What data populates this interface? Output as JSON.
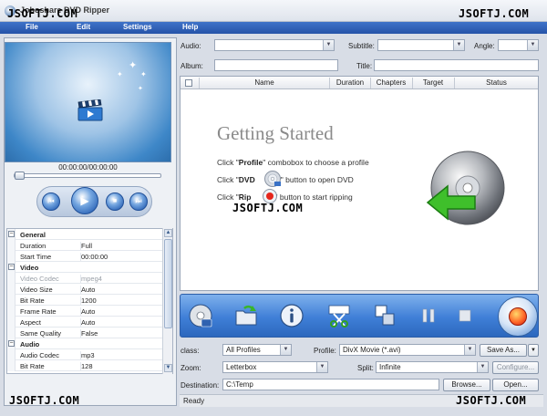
{
  "window": {
    "title": "Joboshare DVD Ripper",
    "watermark": "JSOFTJ.COM"
  },
  "menu": [
    {
      "label": "File"
    },
    {
      "label": "Edit"
    },
    {
      "label": "Settings"
    },
    {
      "label": "Help"
    }
  ],
  "player": {
    "time": "00:00:00/00:00:00",
    "seek_progress": 0.0
  },
  "properties": {
    "groups": [
      {
        "name": "General",
        "rows": [
          {
            "name": "Duration",
            "value": "Full"
          },
          {
            "name": "Start Time",
            "value": "00:00:00"
          }
        ]
      },
      {
        "name": "Video",
        "rows": [
          {
            "name": "Video Codec",
            "value": "mpeg4",
            "disabled": true
          },
          {
            "name": "Video Size",
            "value": "Auto"
          },
          {
            "name": "Bit Rate",
            "value": "1200"
          },
          {
            "name": "Frame Rate",
            "value": "Auto"
          },
          {
            "name": "Aspect",
            "value": "Auto"
          },
          {
            "name": "Same Quality",
            "value": "False"
          }
        ]
      },
      {
        "name": "Audio",
        "rows": [
          {
            "name": "Audio Codec",
            "value": "mp3"
          },
          {
            "name": "Bit Rate",
            "value": "128"
          }
        ]
      }
    ]
  },
  "top_fields": {
    "audio_label": "Audio:",
    "audio_value": "",
    "subtitle_label": "Subtitle:",
    "subtitle_value": "",
    "angle_label": "Angle:",
    "angle_value": "",
    "album_label": "Album:",
    "album_value": "",
    "title_label": "Title:",
    "title_value": ""
  },
  "table": {
    "columns": [
      "Name",
      "Duration",
      "Chapters",
      "Target",
      "Status"
    ],
    "rows": []
  },
  "getting_started": {
    "heading": "Getting Started",
    "line1_pre": "Click \"",
    "line1_bold": "Profile",
    "line1_post": "\" combobox to choose a profile",
    "line2_pre": "Click \"",
    "line2_bold": "DVD",
    "line2_post": "\" button to open DVD",
    "line3_pre": "Click \"",
    "line3_bold": "Rip",
    "line3_post": "\" button to start ripping"
  },
  "toolbar": {
    "buttons": [
      {
        "icon": "dvd-icon"
      },
      {
        "icon": "open-folder-icon"
      },
      {
        "icon": "info-icon"
      },
      {
        "icon": "cut-icon"
      },
      {
        "icon": "merge-icon"
      },
      {
        "icon": "pause-icon"
      },
      {
        "icon": "stop-icon"
      }
    ],
    "rip_icon": "rip-icon"
  },
  "settings": {
    "class_label": "class:",
    "class_value": "All Profiles",
    "profile_label": "Profile:",
    "profile_value": "DivX Movie  (*.avi)",
    "save_as": "Save As...",
    "zoom_label": "Zoom:",
    "zoom_value": "Letterbox",
    "split_label": "Split:",
    "split_value": "Infinite",
    "configure": "Configure...",
    "destination_label": "Destination:",
    "destination_value": "C:\\Temp",
    "browse": "Browse...",
    "open": "Open..."
  },
  "status": {
    "text": "Ready"
  },
  "colors": {
    "menubar": "#2553a8",
    "toolbar": "#3f7fd7",
    "rip": "#ff6a2a"
  }
}
